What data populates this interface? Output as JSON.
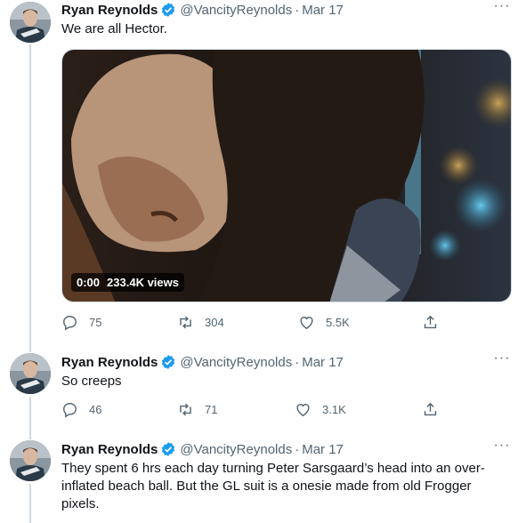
{
  "tweets": [
    {
      "name": "Ryan Reynolds",
      "handle": "@VancityReynolds",
      "separator": "·",
      "date": "Mar 17",
      "more": "···",
      "text": "We are all Hector.",
      "video": {
        "time": "0:00",
        "views": "233.4K views"
      },
      "replies": "75",
      "retweets": "304",
      "likes": "5.5K"
    },
    {
      "name": "Ryan Reynolds",
      "handle": "@VancityReynolds",
      "separator": "·",
      "date": "Mar 17",
      "more": "···",
      "text": "So creeps",
      "replies": "46",
      "retweets": "71",
      "likes": "3.1K"
    },
    {
      "name": "Ryan Reynolds",
      "handle": "@VancityReynolds",
      "separator": "·",
      "date": "Mar 17",
      "more": "···",
      "text": "They spent 6 hrs each day turning Peter Sarsgaard’s head into an over-inflated beach ball. But the GL suit is a onesie made from old Frogger pixels."
    }
  ],
  "colors": {
    "accent": "#1d9bf0",
    "muted": "#536471",
    "line": "#cfd9de"
  },
  "icons": [
    "verified-badge-icon",
    "more-icon",
    "reply-icon",
    "retweet-icon",
    "like-icon",
    "share-icon"
  ]
}
